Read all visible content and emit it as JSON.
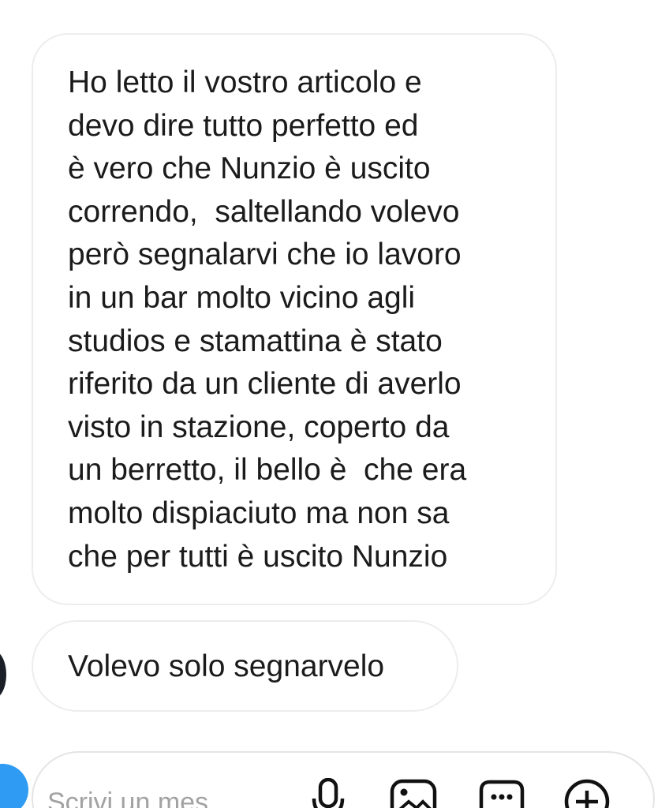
{
  "messages": [
    {
      "text": "Ho letto il vostro articolo e\ndevo dire tutto perfetto ed\nè vero che Nunzio è uscito\ncorrendo,  saltellando volevo\nperò segnalarvi che io lavoro\nin un bar molto vicino agli\nstudios e stamattina è stato\nriferito da un cliente di averlo\nvisto in stazione, coperto da\nun berretto, il bello è  che era\nmolto dispiaciuto ma non sa\nche per tutti è uscito Nunzio"
    },
    {
      "text": "Volevo solo segnarvelo"
    }
  ],
  "composer": {
    "placeholder": "Scrivi un mes...",
    "icons": [
      "camera-icon",
      "mic-icon",
      "gallery-icon",
      "sticker-icon",
      "plus-icon"
    ],
    "accent_color": "#2f9bf2"
  }
}
